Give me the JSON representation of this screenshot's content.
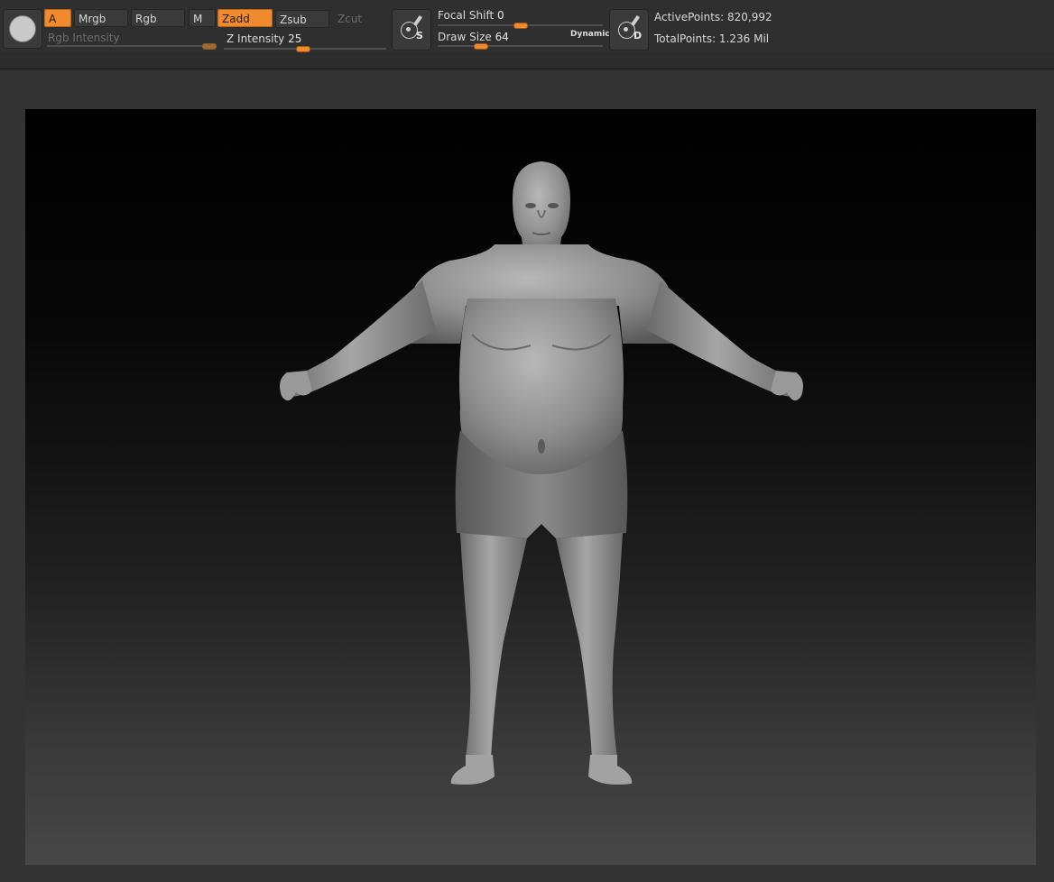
{
  "toolbar": {
    "logo_icon": "zbrush-logo-icon",
    "buttons": {
      "a": "A",
      "mrgb": "Mrgb",
      "rgb": "Rgb",
      "m": "M",
      "zadd": "Zadd",
      "zsub": "Zsub",
      "zcut": "Zcut"
    },
    "rgb_intensity": {
      "label": "Rgb Intensity"
    },
    "z_intensity": {
      "label": "Z Intensity",
      "value": "25"
    },
    "focal_shift": {
      "label": "Focal Shift",
      "value": "0"
    },
    "draw_size": {
      "label": "Draw Size",
      "value": "64",
      "dynamic_label": "Dynamic"
    },
    "standard_brush_icon": {
      "letter": "S"
    },
    "dots_brush_icon": {
      "letter": "D"
    },
    "stats": {
      "active_points": "ActivePoints: 820,992",
      "total_points": "TotalPoints: 1.236 Mil"
    },
    "accent_color": "#f08a2c"
  },
  "viewport": {
    "model": "human-body-sculpt-a-pose"
  }
}
